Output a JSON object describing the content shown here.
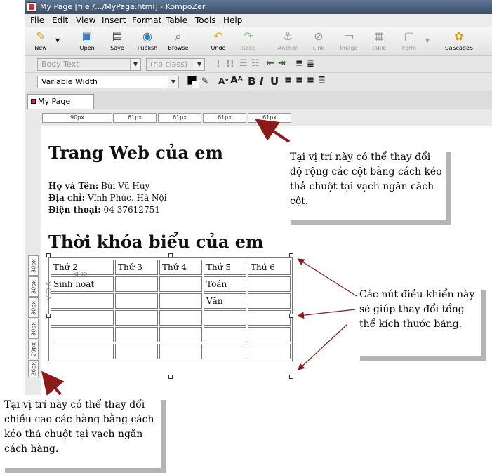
{
  "window": {
    "title": "My Page [file:/.../MyPage.html] - KompoZer"
  },
  "menu": [
    "File",
    "Edit",
    "View",
    "Insert",
    "Format",
    "Table",
    "Tools",
    "Help"
  ],
  "toolbar": [
    {
      "label": "New",
      "icon": "pencil-icon",
      "enabled": true
    },
    {
      "label": "Open",
      "icon": "open-folder-icon",
      "enabled": true
    },
    {
      "label": "Save",
      "icon": "floppy-disk-icon",
      "enabled": true
    },
    {
      "label": "Publish",
      "icon": "globe-icon",
      "enabled": true
    },
    {
      "label": "Browse",
      "icon": "magnifier-icon",
      "enabled": true
    },
    {
      "label": "Undo",
      "icon": "undo-arrow-icon",
      "enabled": true
    },
    {
      "label": "Redo",
      "icon": "redo-arrow-icon",
      "enabled": false
    },
    {
      "label": "Anchor",
      "icon": "anchor-icon",
      "enabled": false
    },
    {
      "label": "Link",
      "icon": "chain-link-icon",
      "enabled": false
    },
    {
      "label": "Image",
      "icon": "image-icon",
      "enabled": false
    },
    {
      "label": "Table",
      "icon": "table-icon",
      "enabled": false
    },
    {
      "label": "Form",
      "icon": "form-icon",
      "enabled": false
    },
    {
      "label": "CaScadeS",
      "icon": "css-palette-icon",
      "enabled": true
    }
  ],
  "format": {
    "paragraph": "Body Text",
    "class": "(no class)",
    "font": "Variable Width"
  },
  "tab": {
    "label": "My Page"
  },
  "ruler": {
    "columns": [
      "90px",
      "61px",
      "61px",
      "61px",
      "61px"
    ],
    "rows": [
      "30px",
      "30px",
      "30px",
      "30px",
      "29px",
      "26px"
    ]
  },
  "page": {
    "title": "Trang Web của em",
    "info": [
      {
        "label": "Họ và Tên:",
        "value": " Bùi Vũ Huy"
      },
      {
        "label": "Địa chỉ:",
        "value": " Vĩnh Phúc, Hà Nội"
      },
      {
        "label": "Điện thoại:",
        "value": " 04-37612751"
      }
    ],
    "section_title": "Thời khóa biểu của em",
    "table": [
      [
        "Thứ 2",
        "Thứ 3",
        "Thứ 4",
        "Thứ 5",
        "Thứ 6"
      ],
      [
        "Sinh hoạt",
        "",
        "",
        "Toán",
        ""
      ],
      [
        "",
        "",
        "",
        "Văn",
        ""
      ],
      [
        "",
        "",
        "",
        "",
        ""
      ],
      [
        "",
        "",
        "",
        "",
        ""
      ],
      [
        "",
        "",
        "",
        "",
        ""
      ]
    ]
  },
  "callouts": {
    "columns": "Tại vị trí này có thể thay đổi độ rộng các cột bằng cách kéo thả chuột tại vạch ngăn cách cột.",
    "handles": "Các nút điều khiển này sẽ giúp thay đổi tổng thể kích thước bảng.",
    "rows": "Tại vị trí này có thể thay đổi chiều cao các hàng bằng cách kéo thả chuột tại vạch ngăn cách hàng."
  },
  "colors": {
    "titlebar": "#4a5f7c",
    "arrow": "#8b1a1a",
    "shadow": "#b5b5b5"
  }
}
